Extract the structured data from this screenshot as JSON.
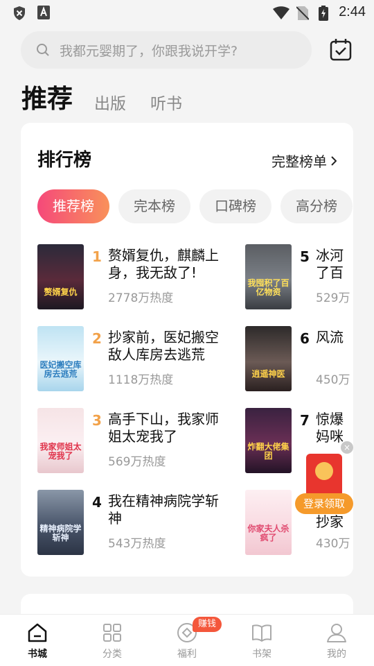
{
  "status_bar": {
    "time": "2:44",
    "icons": [
      "shield-icon",
      "app-a-icon",
      "wifi-icon",
      "no-sim-icon",
      "battery-charging-icon"
    ]
  },
  "search": {
    "placeholder": "我都元婴期了，你跟我说开学?",
    "calendar_icon": "calendar-check-icon"
  },
  "tabs": [
    {
      "label": "推荐",
      "active": true
    },
    {
      "label": "出版",
      "active": false
    },
    {
      "label": "听书",
      "active": false
    }
  ],
  "ranking": {
    "title": "排行榜",
    "full_list_label": "完整榜单",
    "chips": [
      {
        "label": "推荐榜",
        "active": true
      },
      {
        "label": "完本榜",
        "active": false
      },
      {
        "label": "口碑榜",
        "active": false
      },
      {
        "label": "高分榜",
        "active": false
      }
    ],
    "books": [
      {
        "rank": "1",
        "name": "赘婿复仇，麒麟上身，我无敌了!",
        "heat": "2778万热度",
        "cover_text": "赘婿复仇"
      },
      {
        "rank": "2",
        "name": "抄家前，医妃搬空敌人库房去逃荒",
        "heat": "1118万热度",
        "cover_text": "医妃搬空库房去逃荒"
      },
      {
        "rank": "3",
        "name": "高手下山，我家师姐太宠我了",
        "heat": "569万热度",
        "cover_text": "我家师姐太宠我了"
      },
      {
        "rank": "4",
        "name": "我在精神病院学斩神",
        "heat": "543万热度",
        "cover_text": "精神病院学斩神"
      },
      {
        "rank": "5",
        "name": "冰河了百",
        "heat": "529万",
        "cover_text": "我囤积了百亿物资"
      },
      {
        "rank": "6",
        "name": "风流",
        "heat": "450万",
        "cover_text": "逍遥神医"
      },
      {
        "rank": "7",
        "name": "惊爆妈咪",
        "heat": "",
        "cover_text": "炸翻大佬集团"
      },
      {
        "rank": "",
        "name": "抄家",
        "heat": "430万",
        "cover_text": "你家夫人杀疯了"
      }
    ]
  },
  "float_ad": {
    "label": "登录领取",
    "close_label": "×"
  },
  "bottom_nav": [
    {
      "label": "书城",
      "icon": "home-icon",
      "active": true
    },
    {
      "label": "分类",
      "icon": "grid-icon",
      "active": false
    },
    {
      "label": "福利",
      "icon": "coin-icon",
      "active": false,
      "badge": "赚钱"
    },
    {
      "label": "书架",
      "icon": "book-icon",
      "active": false
    },
    {
      "label": "我的",
      "icon": "profile-icon",
      "active": false
    }
  ],
  "colors": {
    "accent_gradient_start": "#f5497a",
    "accent_gradient_end": "#f9915a",
    "rank_top": "#f2a24a",
    "badge": "#f4573b"
  }
}
